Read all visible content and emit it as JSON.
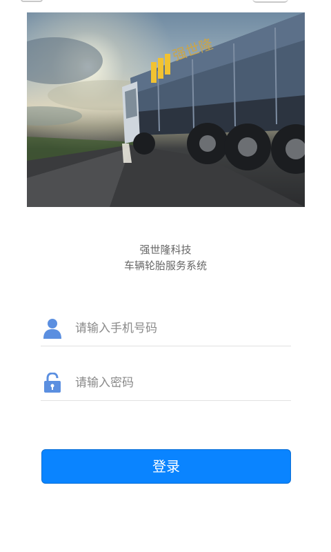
{
  "brand": {
    "company": "强世隆科技",
    "system": "车辆轮胎服务系统"
  },
  "hero_image": {
    "truck_logo_text": "强世隆"
  },
  "form": {
    "phone_placeholder": "请输入手机号码",
    "phone_value": "",
    "password_placeholder": "请输入密码",
    "password_value": ""
  },
  "login_button": {
    "label": "登录"
  },
  "colors": {
    "accent": "#0a84ff",
    "icon_blue": "#5b8fe0",
    "text_gray": "#666666",
    "placeholder_gray": "#8a8a8a"
  },
  "icons": {
    "phone_field": "user-icon",
    "password_field": "lock-icon"
  }
}
